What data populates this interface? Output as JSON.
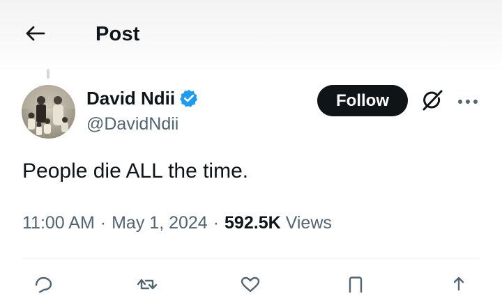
{
  "header": {
    "back_icon": "arrow-left-icon",
    "title": "Post"
  },
  "author": {
    "display_name": "David Ndii",
    "handle": "@DavidNdii",
    "verified": true,
    "verified_icon": "verified-badge-icon",
    "avatar": "avatar-photo"
  },
  "actions_top": {
    "follow_label": "Follow",
    "grok_icon": "grok-icon",
    "more_icon": "more-dots-icon"
  },
  "tweet": {
    "text": "People die ALL the time."
  },
  "meta": {
    "time": "11:00 AM",
    "separator": "·",
    "date": "May 1, 2024",
    "views_count": "592.5K",
    "views_label": "Views"
  },
  "action_bar_icons": [
    "reply-icon",
    "repost-icon",
    "like-icon",
    "bookmark-icon",
    "share-icon"
  ],
  "colors": {
    "text_primary": "#0f1419",
    "text_secondary": "#536471",
    "verified_blue": "#1d9bf0",
    "follow_bg": "#0f1419",
    "follow_text": "#ffffff",
    "divider": "#eff3f4"
  }
}
